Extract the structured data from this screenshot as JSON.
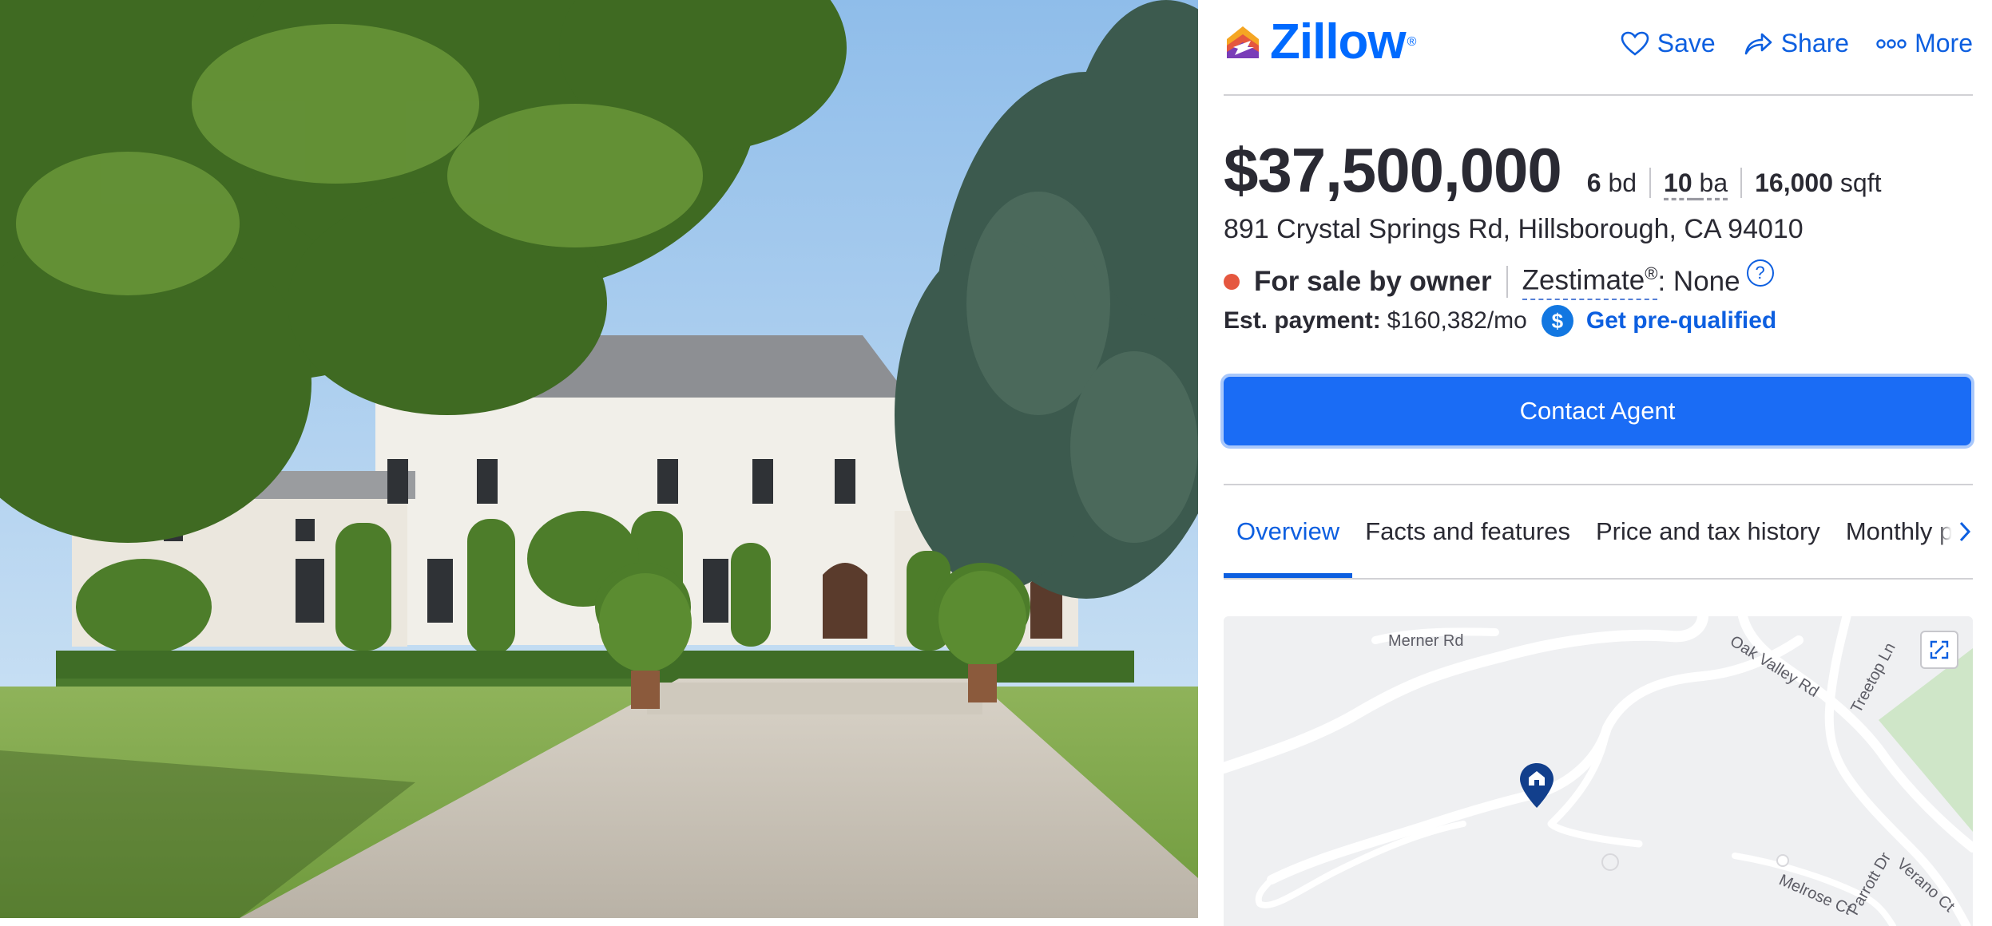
{
  "photo": {
    "alt_subject": "mansion-exterior"
  },
  "header": {
    "logo_text": "Zillow",
    "logo_mark": "®",
    "actions": [
      {
        "label": "Save",
        "icon": "heart-icon"
      },
      {
        "label": "Share",
        "icon": "share-icon"
      },
      {
        "label": "More",
        "icon": "more-icon"
      }
    ]
  },
  "listing": {
    "price": "$37,500,000",
    "beds_num": "6",
    "beds_unit": "bd",
    "baths_num": "10",
    "baths_unit": "ba",
    "sqft_num": "16,000",
    "sqft_unit": "sqft",
    "address": "891 Crystal Springs Rd, Hillsborough, CA 94010",
    "status": "For sale by owner",
    "status_color": "#e5573f",
    "zestimate_label": "Zestimate",
    "zestimate_sup": "®",
    "zestimate_value": ": None",
    "help_glyph": "?",
    "payment_label": "Est. payment:",
    "payment_value": "$160,382/mo",
    "dollar_glyph": "$",
    "prequal_link": "Get pre-qualified"
  },
  "contact": {
    "button_label": "Contact Agent",
    "color": "#1a6cf5"
  },
  "tabs": [
    {
      "label": "Overview",
      "active": true
    },
    {
      "label": "Facts and features"
    },
    {
      "label": "Price and tax history"
    },
    {
      "label": "Monthly payment"
    }
  ],
  "map": {
    "streets": [
      "Merner Rd",
      "Oak Valley Rd",
      "Treetop Ln",
      "Melrose Ct",
      "Parrott Dr",
      "Verano Ct"
    ]
  },
  "colors": {
    "accent": "#0d5fe0",
    "brand": "#006aff"
  }
}
